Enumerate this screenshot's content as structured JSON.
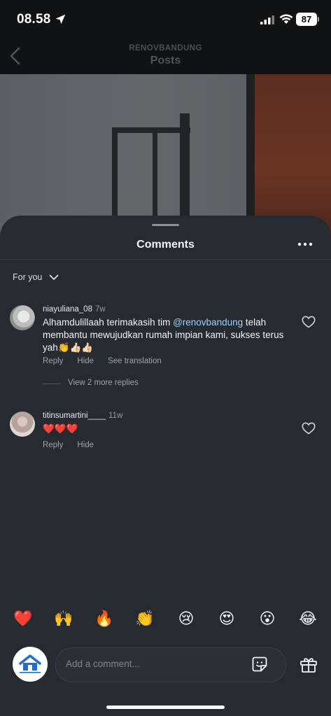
{
  "status_bar": {
    "time": "08.58",
    "battery": "87"
  },
  "header": {
    "account": "RENOVBANDUNG",
    "title": "Posts"
  },
  "comments_sheet": {
    "title": "Comments",
    "filter_label": "For you",
    "comments": [
      {
        "username": "niayuliana_08",
        "age": "7w",
        "text_before": "Alhamdulillaah terimakasih tim ",
        "mention": "@renovbandung",
        "text_after": " telah membantu mewujudkan rumah impian kami, sukses terus yah👏👍🏻👍🏻",
        "reply": "Reply",
        "hide": "Hide",
        "translate": "See translation",
        "view_replies": "View 2 more replies"
      },
      {
        "username": "titinsumartini____",
        "age": "11w",
        "text": "❤️❤️❤️",
        "reply": "Reply",
        "hide": "Hide"
      }
    ],
    "reactions": [
      "❤️",
      "🙌",
      "🔥",
      "👏",
      "😢",
      "😍",
      "😮",
      "😂"
    ],
    "composer": {
      "placeholder": "Add a comment...",
      "avatar_brand": "RENOVASI BANDUNG"
    }
  },
  "colors": {
    "sheet_bg": "#262a31",
    "mention": "#9fd0f5",
    "muted": "#a1a4aa"
  }
}
